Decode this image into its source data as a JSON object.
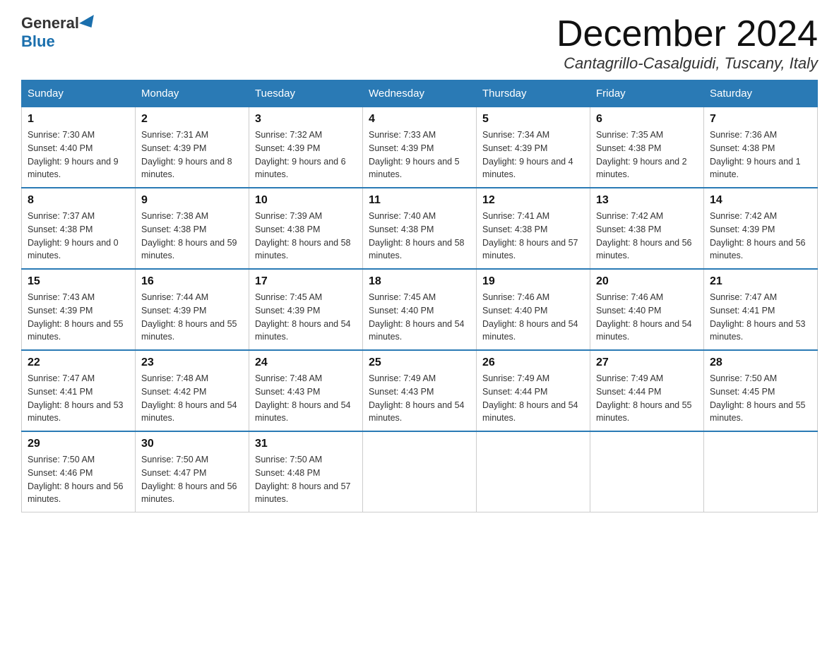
{
  "header": {
    "logo_general": "General",
    "logo_blue": "Blue",
    "month_title": "December 2024",
    "location": "Cantagrillo-Casalguidi, Tuscany, Italy"
  },
  "days_of_week": [
    "Sunday",
    "Monday",
    "Tuesday",
    "Wednesday",
    "Thursday",
    "Friday",
    "Saturday"
  ],
  "weeks": [
    [
      {
        "day": "1",
        "sunrise": "7:30 AM",
        "sunset": "4:40 PM",
        "daylight": "9 hours and 9 minutes."
      },
      {
        "day": "2",
        "sunrise": "7:31 AM",
        "sunset": "4:39 PM",
        "daylight": "9 hours and 8 minutes."
      },
      {
        "day": "3",
        "sunrise": "7:32 AM",
        "sunset": "4:39 PM",
        "daylight": "9 hours and 6 minutes."
      },
      {
        "day": "4",
        "sunrise": "7:33 AM",
        "sunset": "4:39 PM",
        "daylight": "9 hours and 5 minutes."
      },
      {
        "day": "5",
        "sunrise": "7:34 AM",
        "sunset": "4:39 PM",
        "daylight": "9 hours and 4 minutes."
      },
      {
        "day": "6",
        "sunrise": "7:35 AM",
        "sunset": "4:38 PM",
        "daylight": "9 hours and 2 minutes."
      },
      {
        "day": "7",
        "sunrise": "7:36 AM",
        "sunset": "4:38 PM",
        "daylight": "9 hours and 1 minute."
      }
    ],
    [
      {
        "day": "8",
        "sunrise": "7:37 AM",
        "sunset": "4:38 PM",
        "daylight": "9 hours and 0 minutes."
      },
      {
        "day": "9",
        "sunrise": "7:38 AM",
        "sunset": "4:38 PM",
        "daylight": "8 hours and 59 minutes."
      },
      {
        "day": "10",
        "sunrise": "7:39 AM",
        "sunset": "4:38 PM",
        "daylight": "8 hours and 58 minutes."
      },
      {
        "day": "11",
        "sunrise": "7:40 AM",
        "sunset": "4:38 PM",
        "daylight": "8 hours and 58 minutes."
      },
      {
        "day": "12",
        "sunrise": "7:41 AM",
        "sunset": "4:38 PM",
        "daylight": "8 hours and 57 minutes."
      },
      {
        "day": "13",
        "sunrise": "7:42 AM",
        "sunset": "4:38 PM",
        "daylight": "8 hours and 56 minutes."
      },
      {
        "day": "14",
        "sunrise": "7:42 AM",
        "sunset": "4:39 PM",
        "daylight": "8 hours and 56 minutes."
      }
    ],
    [
      {
        "day": "15",
        "sunrise": "7:43 AM",
        "sunset": "4:39 PM",
        "daylight": "8 hours and 55 minutes."
      },
      {
        "day": "16",
        "sunrise": "7:44 AM",
        "sunset": "4:39 PM",
        "daylight": "8 hours and 55 minutes."
      },
      {
        "day": "17",
        "sunrise": "7:45 AM",
        "sunset": "4:39 PM",
        "daylight": "8 hours and 54 minutes."
      },
      {
        "day": "18",
        "sunrise": "7:45 AM",
        "sunset": "4:40 PM",
        "daylight": "8 hours and 54 minutes."
      },
      {
        "day": "19",
        "sunrise": "7:46 AM",
        "sunset": "4:40 PM",
        "daylight": "8 hours and 54 minutes."
      },
      {
        "day": "20",
        "sunrise": "7:46 AM",
        "sunset": "4:40 PM",
        "daylight": "8 hours and 54 minutes."
      },
      {
        "day": "21",
        "sunrise": "7:47 AM",
        "sunset": "4:41 PM",
        "daylight": "8 hours and 53 minutes."
      }
    ],
    [
      {
        "day": "22",
        "sunrise": "7:47 AM",
        "sunset": "4:41 PM",
        "daylight": "8 hours and 53 minutes."
      },
      {
        "day": "23",
        "sunrise": "7:48 AM",
        "sunset": "4:42 PM",
        "daylight": "8 hours and 54 minutes."
      },
      {
        "day": "24",
        "sunrise": "7:48 AM",
        "sunset": "4:43 PM",
        "daylight": "8 hours and 54 minutes."
      },
      {
        "day": "25",
        "sunrise": "7:49 AM",
        "sunset": "4:43 PM",
        "daylight": "8 hours and 54 minutes."
      },
      {
        "day": "26",
        "sunrise": "7:49 AM",
        "sunset": "4:44 PM",
        "daylight": "8 hours and 54 minutes."
      },
      {
        "day": "27",
        "sunrise": "7:49 AM",
        "sunset": "4:44 PM",
        "daylight": "8 hours and 55 minutes."
      },
      {
        "day": "28",
        "sunrise": "7:50 AM",
        "sunset": "4:45 PM",
        "daylight": "8 hours and 55 minutes."
      }
    ],
    [
      {
        "day": "29",
        "sunrise": "7:50 AM",
        "sunset": "4:46 PM",
        "daylight": "8 hours and 56 minutes."
      },
      {
        "day": "30",
        "sunrise": "7:50 AM",
        "sunset": "4:47 PM",
        "daylight": "8 hours and 56 minutes."
      },
      {
        "day": "31",
        "sunrise": "7:50 AM",
        "sunset": "4:48 PM",
        "daylight": "8 hours and 57 minutes."
      },
      null,
      null,
      null,
      null
    ]
  ]
}
